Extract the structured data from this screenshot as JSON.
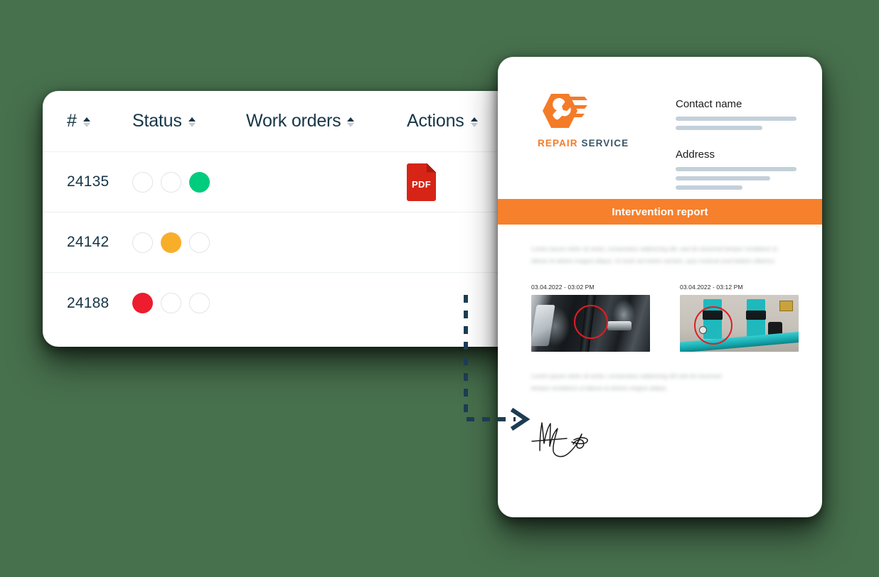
{
  "page": {
    "background_color": "#47704d",
    "accent_orange": "#f6802c",
    "ink_dark": "#173647"
  },
  "work_orders_table": {
    "name": "Work orders table",
    "columns": [
      {
        "label": "#",
        "sort": "asc",
        "key": "number"
      },
      {
        "label": "Status",
        "sort": "asc",
        "key": "status"
      },
      {
        "label": "Work orders",
        "sort": "asc",
        "key": "work_orders"
      },
      {
        "label": "Actions",
        "sort": "asc",
        "key": "actions"
      }
    ],
    "rows": [
      {
        "number": "24135",
        "status_dots": [
          {
            "state": "off",
            "color": "#ffffff"
          },
          {
            "state": "off",
            "color": "#ffffff"
          },
          {
            "state": "on",
            "color": "#00cc7e"
          }
        ],
        "status_value": "green",
        "work_orders_placeholder": true,
        "action": {
          "icon": "pdf-file-icon",
          "label": "PDF",
          "color": "#d62516"
        }
      },
      {
        "number": "24142",
        "status_dots": [
          {
            "state": "off",
            "color": "#ffffff"
          },
          {
            "state": "on",
            "color": "#f9ae2a"
          },
          {
            "state": "off",
            "color": "#ffffff"
          }
        ],
        "status_value": "amber",
        "work_orders_placeholder": true,
        "action": null
      },
      {
        "number": "24188",
        "status_dots": [
          {
            "state": "on",
            "color": "#ed1c2e"
          },
          {
            "state": "off",
            "color": "#ffffff"
          },
          {
            "state": "off",
            "color": "#ffffff"
          }
        ],
        "status_value": "red",
        "work_orders_placeholder": true,
        "action": null
      }
    ]
  },
  "report": {
    "brand": {
      "mark": "wrench-speed-hexagon-logo",
      "word_1": "REPAIR",
      "word_2": "SERVICE",
      "word_1_color": "#f47b28",
      "word_2_color": "#3c5667"
    },
    "fields": [
      {
        "label": "Contact name",
        "line_widths": [
          "100%",
          "72%"
        ]
      },
      {
        "label": "Address",
        "line_widths": [
          "100%",
          "78%",
          "55%"
        ]
      }
    ],
    "banner": {
      "title": "Intervention report",
      "color": "#f6802c"
    },
    "intro_text": "Lorem ipsum dolor sit amet, consectetur adipiscing elit, sed do eiusmod tempor incididunt ut labore et dolore magna aliqua. Ut enim ad minim veniam, quis nostrud exercitation ullamco.",
    "photos": [
      {
        "timestamp": "03.04.2022 - 03:02 PM",
        "caption": "engine-bay-photo",
        "annotation": "red-circle-marker"
      },
      {
        "timestamp": "03.04.2022 - 03:12 PM",
        "caption": "industrial-pumps-photo",
        "annotation": "red-circle-marker"
      }
    ],
    "closing_text": "Lorem ipsum dolor sit amet, consectetur adipiscing elit sed do eiusmod tempor incididunt ut labore et dolore magna aliqua.",
    "signature": {
      "type": "handwritten-signature",
      "color": "#1a1a1a"
    }
  },
  "connector": {
    "name": "dashed-flow-arrow",
    "style": "dashed",
    "color": "#1d3c52",
    "direction": "down-then-right"
  }
}
